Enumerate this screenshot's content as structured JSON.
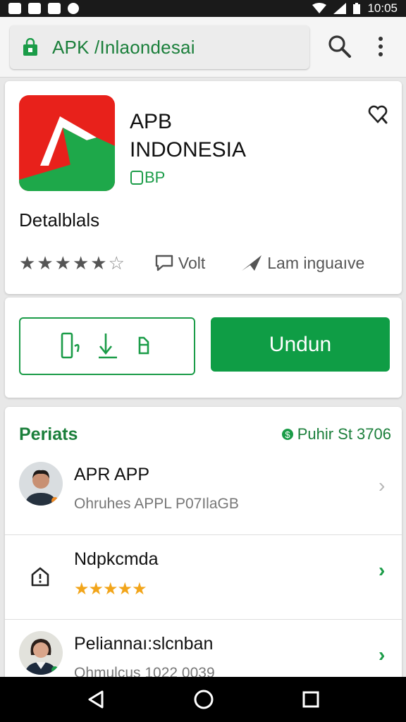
{
  "status_bar": {
    "time": "10:05"
  },
  "url_bar": {
    "url": "APK /Inlaondesai"
  },
  "app": {
    "title": "APB\nINDONESIA",
    "badge": "BP",
    "details_label": "Detalblals",
    "rating": 4.5,
    "vote_label": "Volt",
    "language_label": "Lam inguaıve"
  },
  "actions": {
    "install_label": "Undun"
  },
  "list": {
    "title": "Periats",
    "meta": "Puhir St 3706",
    "rows": [
      {
        "title": "APR APP",
        "subtitle": "Ohruhes APPL P07IlaGB"
      },
      {
        "title": "Ndpkcmda",
        "rating": 4.5
      },
      {
        "title": "Peliannaı:slcnban",
        "subtitle": "Ohmulcus 1022 0039"
      }
    ]
  },
  "colors": {
    "accent": "#0f9d45",
    "brand_red": "#e8211b"
  }
}
